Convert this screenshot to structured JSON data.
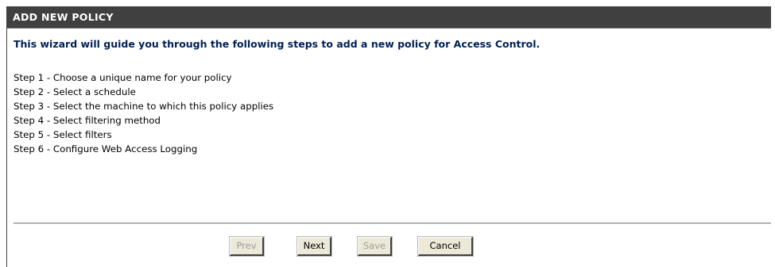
{
  "header": {
    "title": "ADD NEW POLICY"
  },
  "intro": {
    "text": "This wizard will guide you through the following steps to add a new policy for Access Control."
  },
  "steps": [
    "Step 1 - Choose a unique name for your policy",
    "Step 2 - Select a schedule",
    "Step 3 - Select the machine to which this policy applies",
    "Step 4 - Select filtering method",
    "Step 5 - Select filters",
    "Step 6 - Configure Web Access Logging"
  ],
  "buttons": {
    "prev": {
      "label": "Prev",
      "enabled": false
    },
    "next": {
      "label": "Next",
      "enabled": true
    },
    "save": {
      "label": "Save",
      "enabled": false
    },
    "cancel": {
      "label": "Cancel",
      "enabled": true
    }
  },
  "colors": {
    "header_bg": "#404040",
    "header_text": "#ffffff",
    "intro_text": "#002057",
    "disabled_text": "#9d9d9d"
  }
}
